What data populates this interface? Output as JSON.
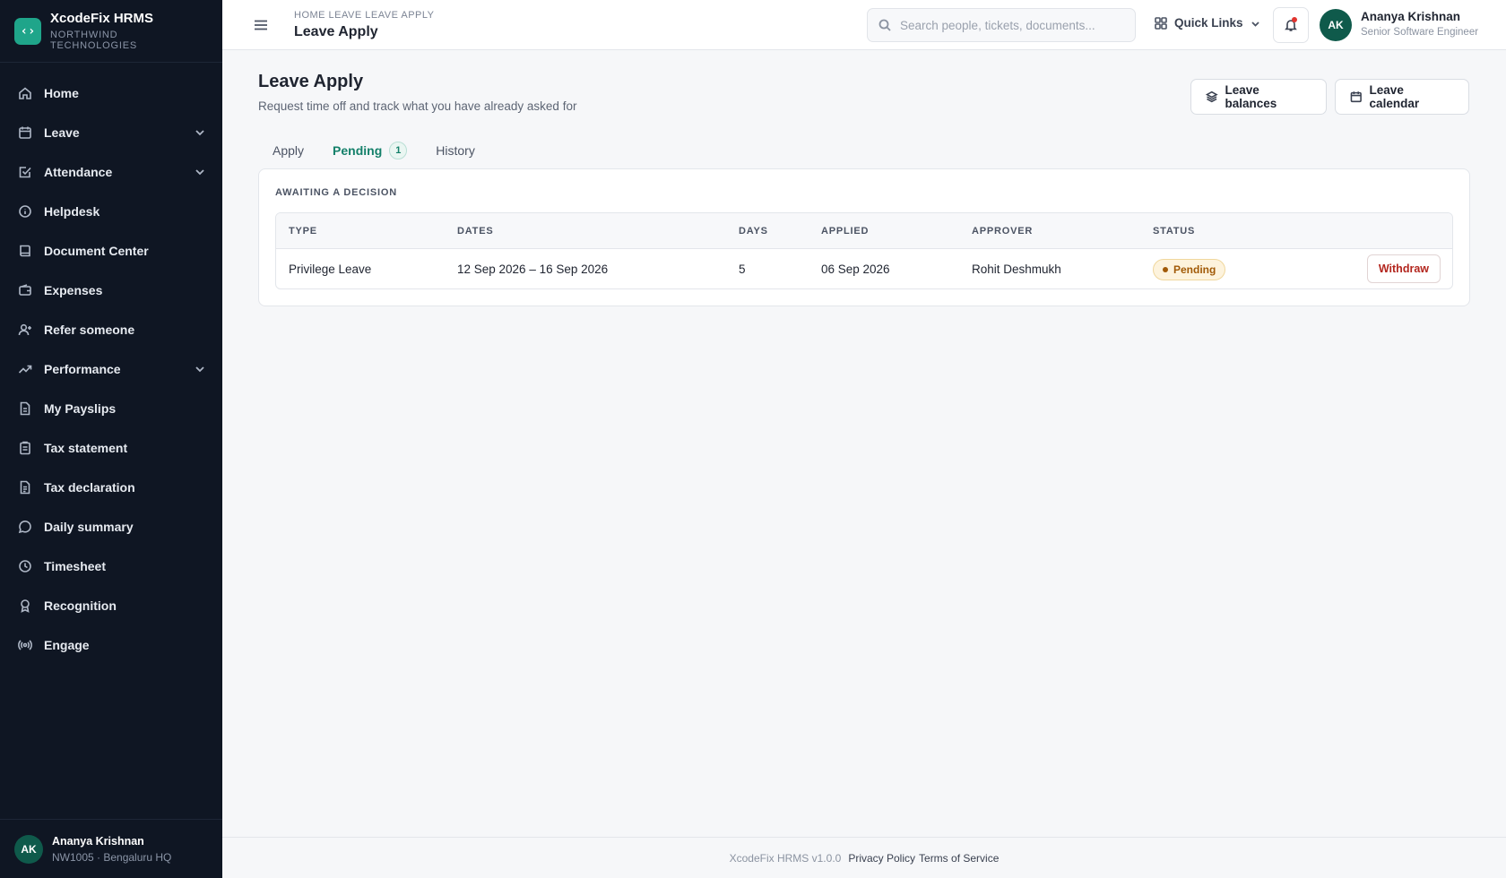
{
  "brand": {
    "logo_glyph": "‹›",
    "name": "XcodeFix HRMS",
    "company": "NORTHWIND TECHNOLOGIES",
    "accent": "#1fa58a"
  },
  "sidebar": {
    "items": [
      {
        "label": "Home",
        "icon": "home-icon",
        "expandable": false
      },
      {
        "label": "Leave",
        "icon": "calendar-icon",
        "expandable": true
      },
      {
        "label": "Attendance",
        "icon": "calendar-check-icon",
        "expandable": true
      },
      {
        "label": "Helpdesk",
        "icon": "info-icon",
        "expandable": false
      },
      {
        "label": "Document Center",
        "icon": "book-icon",
        "expandable": false
      },
      {
        "label": "Expenses",
        "icon": "wallet-icon",
        "expandable": false
      },
      {
        "label": "Refer someone",
        "icon": "user-plus-icon",
        "expandable": false
      },
      {
        "label": "Performance",
        "icon": "trending-up-icon",
        "expandable": true
      },
      {
        "label": "My Payslips",
        "icon": "file-icon",
        "expandable": false
      },
      {
        "label": "Tax statement",
        "icon": "clipboard-icon",
        "expandable": false
      },
      {
        "label": "Tax declaration",
        "icon": "file-text-icon",
        "expandable": false
      },
      {
        "label": "Daily summary",
        "icon": "message-circle-icon",
        "expandable": false
      },
      {
        "label": "Timesheet",
        "icon": "clock-icon",
        "expandable": false
      },
      {
        "label": "Recognition",
        "icon": "award-icon",
        "expandable": false
      },
      {
        "label": "Engage",
        "icon": "broadcast-icon",
        "expandable": false
      }
    ],
    "user": {
      "initials": "AK",
      "name": "Ananya Krishnan",
      "meta": "NW1005 · Bengaluru HQ"
    }
  },
  "topbar": {
    "breadcrumb": "HOME LEAVE LEAVE APPLY",
    "title": "Leave Apply",
    "search_placeholder": "Search people, tickets, documents...",
    "quick_links": "Quick Links",
    "user": {
      "initials": "AK",
      "name": "Ananya Krishnan",
      "role": "Senior Software Engineer"
    }
  },
  "page": {
    "title": "Leave Apply",
    "subtitle": "Request time off and track what you have already asked for",
    "btn_balances": "Leave balances",
    "btn_calendar": "Leave calendar",
    "tabs": [
      {
        "label": "Apply"
      },
      {
        "label": "Pending",
        "badge": "1",
        "active": true
      },
      {
        "label": "History"
      }
    ],
    "card_label": "AWAITING A DECISION",
    "columns": [
      "TYPE",
      "DATES",
      "DAYS",
      "APPLIED",
      "APPROVER",
      "STATUS"
    ],
    "rows": [
      {
        "type": "Privilege Leave",
        "dates": "12 Sep 2026 – 16 Sep 2026",
        "days": "5",
        "applied": "06 Sep 2026",
        "approver": "Rohit Deshmukh",
        "status": "Pending",
        "action": "Withdraw"
      }
    ]
  },
  "footer": {
    "version": "XcodeFix HRMS v1.0.0",
    "privacy": "Privacy Policy",
    "terms": "Terms of Service"
  }
}
